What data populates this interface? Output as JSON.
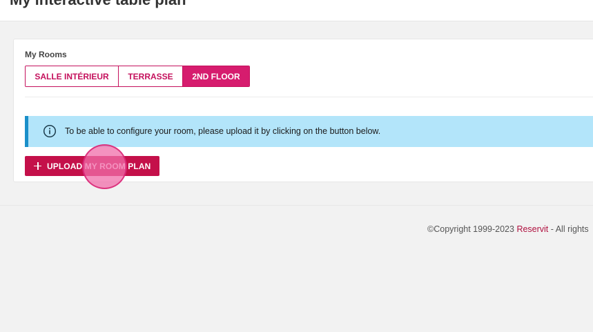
{
  "header": {
    "title": "My interactive table plan"
  },
  "rooms": {
    "label": "My Rooms",
    "tabs": [
      {
        "label": "SALLE INTÉRIEUR",
        "active": false
      },
      {
        "label": "TERRASSE",
        "active": false
      },
      {
        "label": "2ND FLOOR",
        "active": true
      }
    ]
  },
  "alert": {
    "icon": "info-circle-icon",
    "text": "To be able to configure your room, please upload it by clicking on the button below."
  },
  "upload": {
    "icon": "plus-icon",
    "label": "UPLOAD MY ROOM PLAN"
  },
  "footer": {
    "copyright_prefix": "©Copyright 1999-2023 ",
    "brand": "Reservit",
    "copyright_suffix": " - All rights"
  },
  "colors": {
    "accent": "#d61c6e",
    "button": "#c4104a",
    "info_bg": "#b3e5fa",
    "info_border": "#1a8fc9"
  }
}
